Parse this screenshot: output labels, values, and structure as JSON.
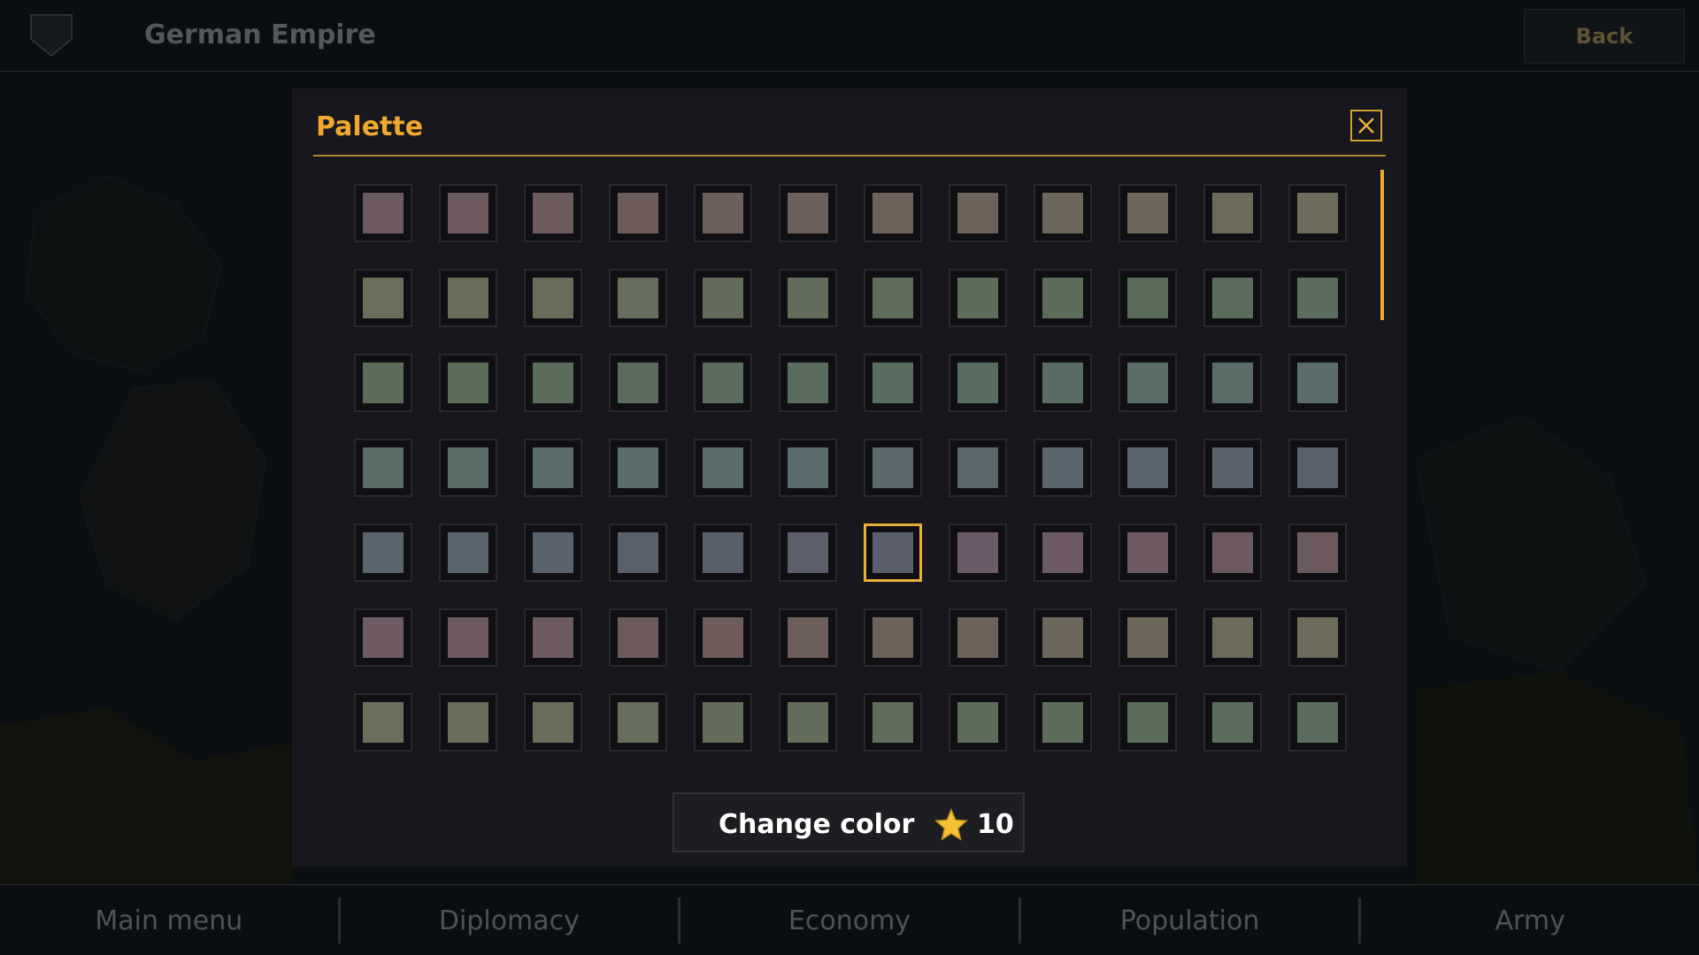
{
  "header": {
    "country_name": "German Empire",
    "back_label": "Back"
  },
  "modal": {
    "title": "Palette",
    "change_color_label": "Change color",
    "cost": "10",
    "selected_index": 54,
    "swatch_colors": [
      "#6d5a60",
      "#6d5a5e",
      "#6d5a5c",
      "#6d5c5a",
      "#6d5e5a",
      "#6d5f5a",
      "#6d615a",
      "#6d635a",
      "#6d665a",
      "#6d685a",
      "#6d6a5a",
      "#6d6c5a",
      "#6c6d5a",
      "#6a6d5a",
      "#686d5a",
      "#666d5a",
      "#646d5a",
      "#626d5a",
      "#606d5a",
      "#5e6d5a",
      "#5c6d5a",
      "#5a6d5a",
      "#5a6d5c",
      "#5a6d5e",
      "#5e6d5a",
      "#5c6d5a",
      "#5a6d5a",
      "#5a6d5c",
      "#5a6d5e",
      "#5a6d5f",
      "#5a6d61",
      "#5a6d63",
      "#5a6d65",
      "#5a6d67",
      "#5a6d69",
      "#5a6d6b",
      "#5a6d68",
      "#5a6d69",
      "#5a6d6a",
      "#5a6d6b",
      "#5a6d6c",
      "#5a6c6d",
      "#5a6a6d",
      "#5a686d",
      "#5a666d",
      "#5a646d",
      "#5a626d",
      "#5a616d",
      "#5a666d",
      "#5a646d",
      "#5a626d",
      "#5a606d",
      "#5a5f6d",
      "#5d5f6d",
      "#5a5e6d",
      "#6d5a69",
      "#6d5a66",
      "#6d5a63",
      "#6d5a60",
      "#6d5a5e",
      "#6d5a63",
      "#6d5a60",
      "#6d5a5e",
      "#6d5a5c",
      "#6d5c5a",
      "#6d5e5a",
      "#6d615a",
      "#6d635a",
      "#6d665a",
      "#6d685a",
      "#6d6a5a",
      "#6d6c5a",
      "#6c6d5a",
      "#6a6d5a",
      "#686d5a",
      "#666d5a",
      "#646d5a",
      "#626d5a",
      "#606d5a",
      "#5e6d5a",
      "#5c6d5a",
      "#5a6d5a",
      "#5a6d5c",
      "#5a6d5e"
    ]
  },
  "nav": [
    {
      "label": "Main menu"
    },
    {
      "label": "Diplomacy"
    },
    {
      "label": "Economy"
    },
    {
      "label": "Population"
    },
    {
      "label": "Army"
    }
  ]
}
